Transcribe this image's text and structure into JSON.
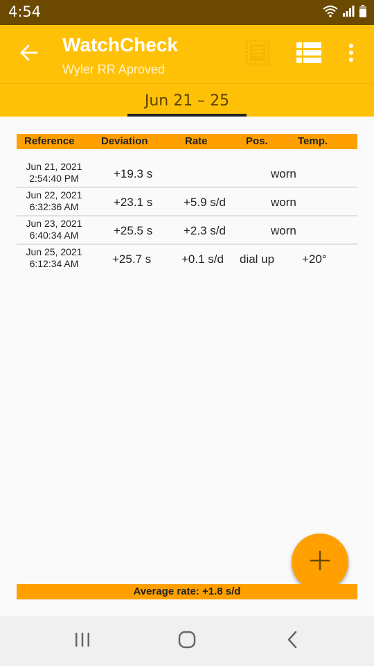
{
  "status": {
    "time": "4:54"
  },
  "appbar": {
    "title": "WatchCheck",
    "subtitle": "Wyler RR Aproved"
  },
  "tab": {
    "label": "Jun 21 – 25"
  },
  "table": {
    "headers": [
      "Reference",
      "Deviation",
      "Rate",
      "Pos.",
      "Temp."
    ],
    "rows": [
      {
        "date": "Jun 21, 2021",
        "time": "2:54:40 PM",
        "deviation": "+19.3 s",
        "rate": "",
        "pos": "worn",
        "temp": ""
      },
      {
        "date": "Jun 22, 2021",
        "time": "6:32:36 AM",
        "deviation": "+23.1 s",
        "rate": "+5.9 s/d",
        "pos": "worn",
        "temp": ""
      },
      {
        "date": "Jun 23, 2021",
        "time": "6:40:34 AM",
        "deviation": "+25.5 s",
        "rate": "+2.3 s/d",
        "pos": "worn",
        "temp": ""
      },
      {
        "date": "Jun 25, 2021",
        "time": "6:12:34 AM",
        "deviation": "+25.7 s",
        "rate": "+0.1 s/d",
        "pos": "dial up",
        "temp": "+20°"
      }
    ]
  },
  "footer": {
    "average": "Average rate: +1.8 s/d"
  },
  "icons": {
    "back": "arrow-left-icon",
    "certificate": "certificate-icon",
    "list": "list-view-icon",
    "more": "more-vert-icon",
    "add": "add-icon"
  },
  "colors": {
    "primary": "#ffc107",
    "accent": "#ffa000",
    "status_bar": "#6b4900"
  }
}
